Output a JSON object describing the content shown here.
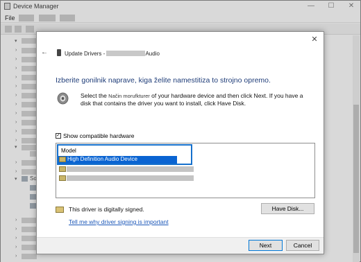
{
  "window": {
    "title": "Device Manager",
    "controls": {
      "minimize": "—",
      "maximize": "☐",
      "close": "✕"
    }
  },
  "menu": {
    "file": "File"
  },
  "tree": {
    "visible_node": "So"
  },
  "dialog": {
    "close_glyph": "✕",
    "back_glyph": "←",
    "header_prefix": "Update Drivers - ",
    "header_suffix": "Audio",
    "heading": "Izberite gonilnik naprave, kiga želite namestitiza to strojno opremo.",
    "instruction_part1": "Select the ",
    "manufacturer": "Način morufkturer",
    "instruction_part2": " of your hardware device and then click Next. If you have a disk that contains the driver you want to install, click Have Disk.",
    "show_compatible_label": "Show compatible hardware",
    "show_compatible_checked": "✓",
    "list_header": "Model",
    "selected_model": "High Definition Audio Device",
    "signed_text": "This driver is digitally signed.",
    "signing_link": "Tell me why driver signing is important",
    "have_disk_label": "Have Disk...",
    "next_label": "Next",
    "cancel_label": "Cancel"
  },
  "icons": {
    "back": "back-arrow-icon",
    "device": "device-icon",
    "speaker": "speaker-icon",
    "signed": "signed-driver-icon"
  },
  "colors": {
    "selection": "#0a64d2",
    "focus_outline": "#1570cc",
    "heading": "#1e3c78",
    "link": "#1a56b8"
  }
}
